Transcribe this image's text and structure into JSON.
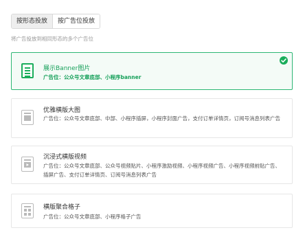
{
  "tabs": [
    {
      "label": "按形态投放",
      "active": true
    },
    {
      "label": "按广告位投放",
      "active": false
    }
  ],
  "hint": "将广告投放到相同形态的多个广告位",
  "options": [
    {
      "title": "展示Banner图片",
      "desc": "广告位：公众号文章底部、小程序banner",
      "selected": true,
      "icon": "banner-image-icon"
    },
    {
      "title": "优雅横版大图",
      "desc": "广告位：公众号文章底部、中部、小程序插屏，小程序封面广告，支付订单详情页，订阅号消息列表广告",
      "selected": false,
      "icon": "large-image-icon"
    },
    {
      "title": "沉浸式横版视频",
      "desc": "广告位：公众号文章底部、公众号视频贴片、小程序激励视频、小程序视频广告、小程序视频前贴广告、插屏广告、支付订单详情页、订阅号消息列表广告",
      "selected": false,
      "icon": "video-icon"
    },
    {
      "title": "横版聚合格子",
      "desc": "广告位：公众号文章底部、小程序格子广告",
      "selected": false,
      "icon": "grid-icon"
    }
  ],
  "colors": {
    "accent": "#1aad5b",
    "selected_bg": "#f4fbf7",
    "border": "#e6e6e6"
  }
}
